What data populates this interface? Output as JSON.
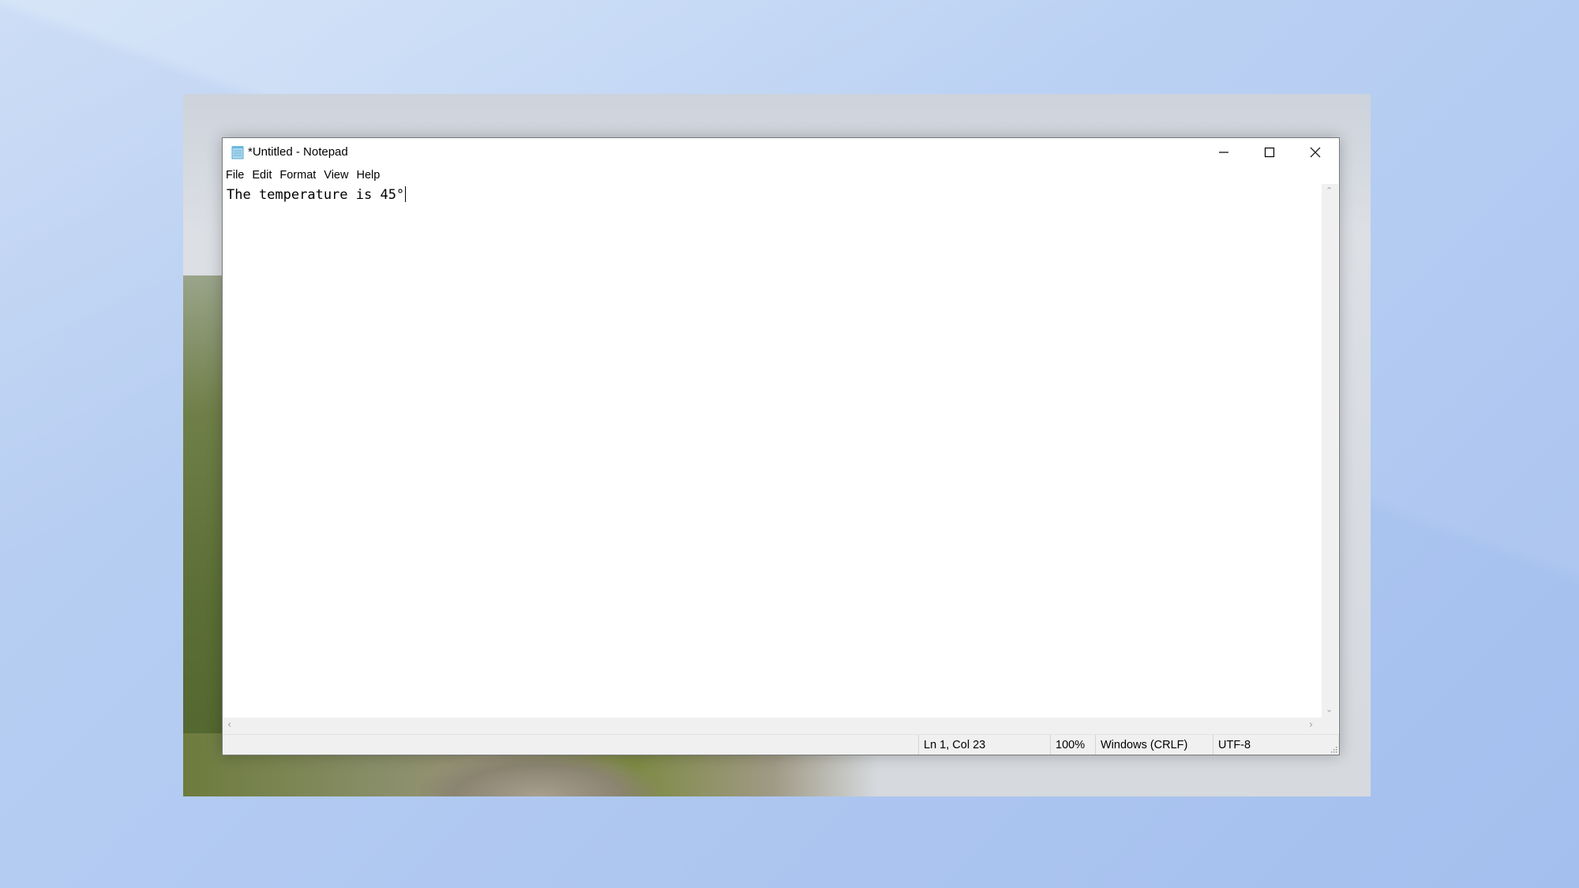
{
  "window": {
    "title": "*Untitled - Notepad",
    "app_icon": "notepad-icon",
    "controls": {
      "minimize_icon": "minimize-icon",
      "maximize_icon": "maximize-icon",
      "close_icon": "close-icon"
    }
  },
  "menu": {
    "items": [
      {
        "label": "File"
      },
      {
        "label": "Edit"
      },
      {
        "label": "Format"
      },
      {
        "label": "View"
      },
      {
        "label": "Help"
      }
    ]
  },
  "editor": {
    "content": "The temperature is 45°"
  },
  "statusbar": {
    "position": "Ln 1, Col 23",
    "zoom": "100%",
    "line_ending": "Windows (CRLF)",
    "encoding": "UTF-8"
  },
  "colors": {
    "window_bg": "#ffffff",
    "chrome_bg": "#f0f0f0",
    "desktop_accent": "#bdd3f4"
  }
}
